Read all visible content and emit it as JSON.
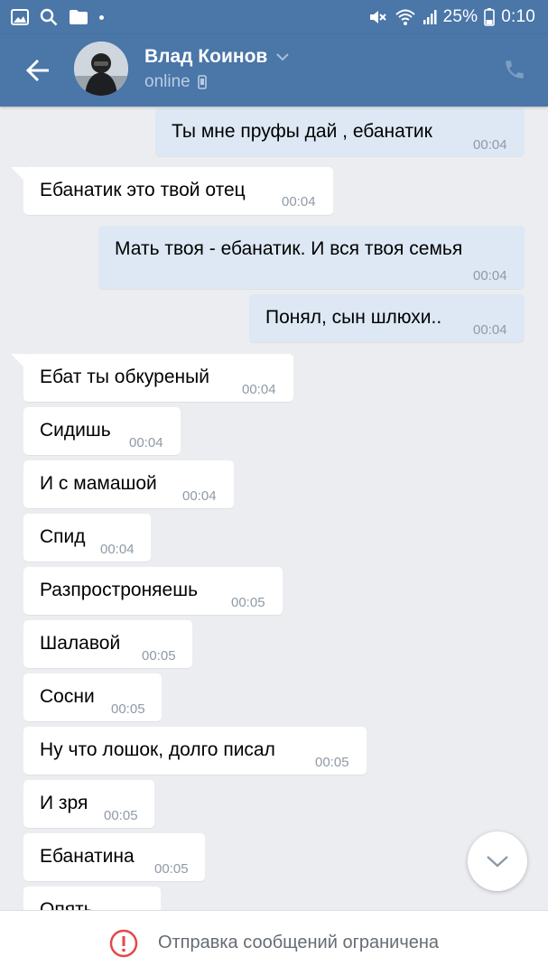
{
  "status_bar": {
    "left_icons": [
      "image-icon",
      "search-icon",
      "folder-icon",
      "dot-icon"
    ],
    "battery_percent": "25%",
    "time": "0:10"
  },
  "header": {
    "contact_name": "Влад Коинов",
    "status": "online",
    "bg_color": "#4a76a8"
  },
  "messages": [
    {
      "dir": "out",
      "text": "Ты мне пруфы дай , ебанатик",
      "time": "00:04"
    },
    {
      "dir": "in",
      "text": "Ебанатик это твой отец",
      "time": "00:04"
    },
    {
      "dir": "out",
      "text": "Мать твоя - ебанатик. И вся твоя семья",
      "time": "00:04"
    },
    {
      "dir": "out",
      "text": "Понял, сын шлюхи..",
      "time": "00:04"
    },
    {
      "dir": "in",
      "text": "Ебат ты обкуреный",
      "time": "00:04"
    },
    {
      "dir": "in",
      "text": "Сидишь",
      "time": "00:04"
    },
    {
      "dir": "in",
      "text": "И с мамашой",
      "time": "00:04"
    },
    {
      "dir": "in",
      "text": "Спид",
      "time": "00:04"
    },
    {
      "dir": "in",
      "text": "Разпростроняешь",
      "time": "00:05"
    },
    {
      "dir": "in",
      "text": "Шалавой",
      "time": "00:05"
    },
    {
      "dir": "in",
      "text": "Сосни",
      "time": "00:05"
    },
    {
      "dir": "in",
      "text": "Ну что лошок, долго писал",
      "time": "00:05"
    },
    {
      "dir": "in",
      "text": "И зря",
      "time": "00:05"
    },
    {
      "dir": "in",
      "text": "Ебанатина",
      "time": "00:05"
    },
    {
      "dir": "in",
      "text": "Опять",
      "time": ""
    }
  ],
  "bottom_bar": {
    "text": "Отправка сообщений ограничена",
    "icon": "alert-circle-icon",
    "icon_color": "#e64646"
  }
}
